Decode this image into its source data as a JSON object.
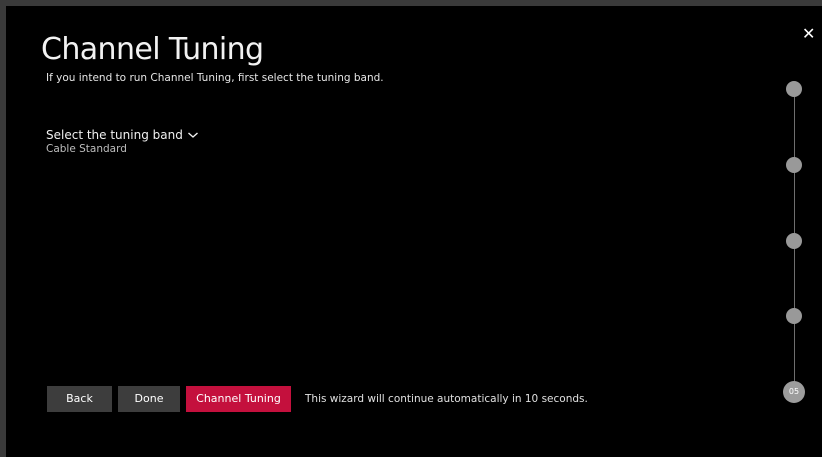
{
  "wizard": {
    "title": "Channel Tuning",
    "subtitle": "If you intend to run Channel Tuning, first select the tuning band.",
    "close_symbol": "✕"
  },
  "tuning_band": {
    "label": "Select the tuning band",
    "value": "Cable Standard",
    "icon": "chevron-down-icon"
  },
  "footer": {
    "buttons": {
      "back": "Back",
      "done": "Done",
      "channel_tuning": "Channel Tuning"
    },
    "countdown_text": "This wizard will continue automatically in 10 seconds."
  },
  "progress": {
    "current_step_label": "05"
  },
  "colors": {
    "accent": "#c4103d",
    "button": "#3d3d3d",
    "background": "#000000",
    "step": "#999999"
  }
}
